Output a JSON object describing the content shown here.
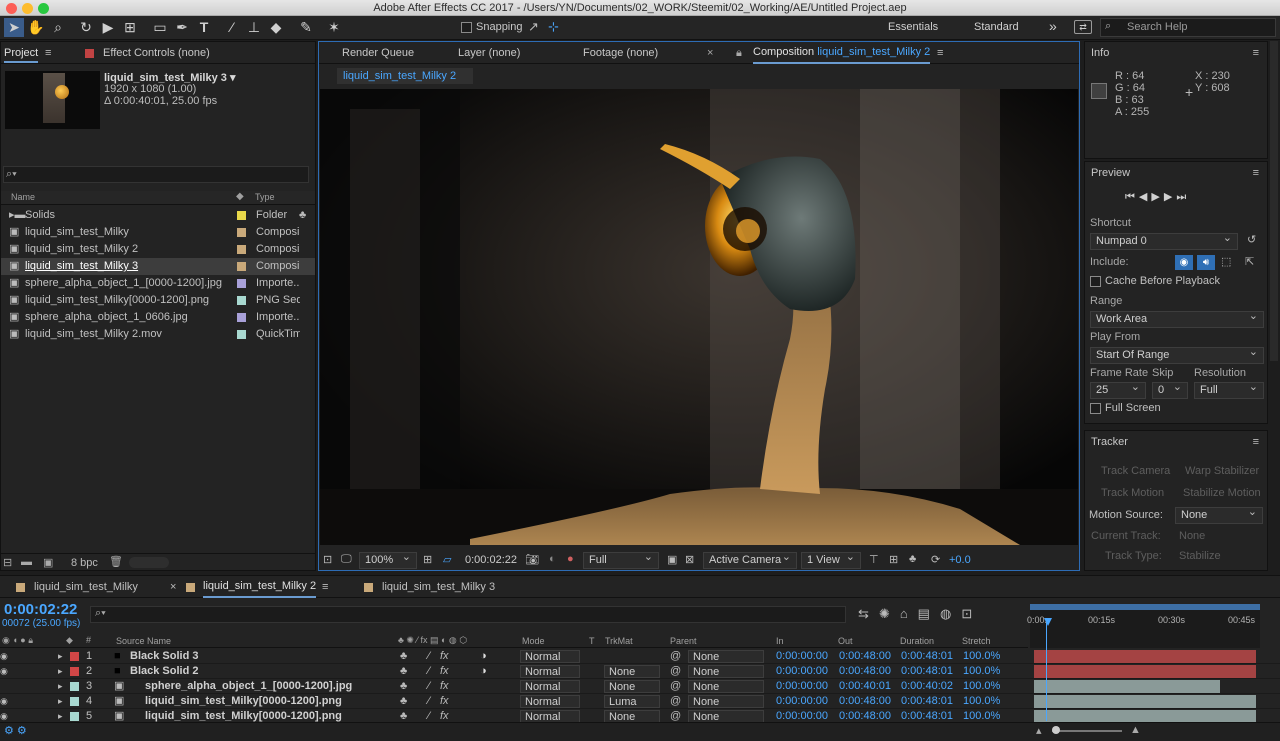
{
  "titlebar": {
    "title": "Adobe After Effects CC 2017 - /Users/YN/Documents/02_WORK/Steemit/02_Working/AE/Untitled Project.aep"
  },
  "toolbar": {
    "snapping": "Snapping",
    "workspaces": [
      "Essentials",
      "Standard"
    ],
    "search_placeholder": "Search Help"
  },
  "project": {
    "tab": "Project",
    "effect_controls": "Effect Controls (none)",
    "selected_name": "liquid_sim_test_Milky 3",
    "dimensions": "1920 x 1080 (1.00)",
    "duration": "Δ 0:00:40:01, 25.00 fps",
    "col_name": "Name",
    "col_type": "Type",
    "bpc": "8 bpc",
    "items": [
      {
        "name": "Solids",
        "type": "Folder",
        "color": "#e8d84a"
      },
      {
        "name": "liquid_sim_test_Milky",
        "type": "Composi",
        "color": "#c9a97a"
      },
      {
        "name": "liquid_sim_test_Milky 2",
        "type": "Composi",
        "color": "#c9a97a"
      },
      {
        "name": "liquid_sim_test_Milky 3",
        "type": "Composi",
        "color": "#c9a97a"
      },
      {
        "name": "sphere_alpha_object_1_[0000-1200].jpg",
        "type": "Importe...",
        "color": "#a8a0d8"
      },
      {
        "name": "liquid_sim_test_Milky[0000-1200].png",
        "type": "PNG Seq.",
        "color": "#a8d8d0"
      },
      {
        "name": "sphere_alpha_object_1_0606.jpg",
        "type": "Importe...",
        "color": "#a8a0d8"
      },
      {
        "name": "liquid_sim_test_Milky 2.mov",
        "type": "QuickTim",
        "color": "#a8d8d0"
      }
    ]
  },
  "viewer": {
    "tabs": [
      "Render Queue",
      "Layer (none)",
      "Footage (none)"
    ],
    "comp_prefix": "Composition",
    "comp_name": "liquid_sim_test_Milky 2",
    "subtab": "liquid_sim_test_Milky 2",
    "zoom": "100%",
    "timecode": "0:00:02:22",
    "resolution": "Full",
    "camera": "Active Camera",
    "views": "1 View",
    "exposure": "+0.0"
  },
  "info": {
    "title": "Info",
    "r": "R : 64",
    "g": "G : 64",
    "b": "B : 63",
    "a": "A : 255",
    "x": "X : 230",
    "y": "Y : 608"
  },
  "preview": {
    "title": "Preview",
    "shortcut_label": "Shortcut",
    "shortcut": "Numpad 0",
    "include": "Include:",
    "cache": "Cache Before Playback",
    "range_label": "Range",
    "range": "Work Area",
    "playfrom_label": "Play From",
    "playfrom": "Start Of Range",
    "framerate_label": "Frame Rate",
    "skip_label": "Skip",
    "resolution_label": "Resolution",
    "framerate": "25",
    "skip": "0",
    "resolution": "Full",
    "fullscreen": "Full Screen"
  },
  "tracker": {
    "title": "Tracker",
    "track_camera": "Track Camera",
    "warp": "Warp Stabilizer",
    "track_motion": "Track Motion",
    "stabilize": "Stabilize Motion",
    "motion_source_label": "Motion Source:",
    "motion_source": "None",
    "current_track_label": "Current Track:",
    "current_track": "None",
    "track_type_label": "Track Type:",
    "track_type": "Stabilize"
  },
  "timeline": {
    "tabs": [
      "liquid_sim_test_Milky",
      "liquid_sim_test_Milky 2",
      "liquid_sim_test_Milky 3"
    ],
    "timecode": "0:00:02:22",
    "frames": "00072 (25.00 fps)",
    "cols": {
      "source": "Source Name",
      "mode": "Mode",
      "t": "T",
      "trkmat": "TrkMat",
      "parent": "Parent",
      "in": "In",
      "out": "Out",
      "duration": "Duration",
      "stretch": "Stretch"
    },
    "ruler": [
      "0:00s",
      "00:15s",
      "00:30s",
      "00:45s"
    ],
    "layers": [
      {
        "num": "1",
        "name": "Black Solid 3",
        "color": "#d04646",
        "mode": "Normal",
        "trkmat": "",
        "parent": "None",
        "in": "0:00:00:00",
        "out": "0:00:48:00",
        "dur": "0:00:48:01",
        "stretch": "100.0%"
      },
      {
        "num": "2",
        "name": "Black Solid 2",
        "color": "#d04646",
        "mode": "Normal",
        "trkmat": "None",
        "parent": "None",
        "in": "0:00:00:00",
        "out": "0:00:48:00",
        "dur": "0:00:48:01",
        "stretch": "100.0%"
      },
      {
        "num": "3",
        "name": "sphere_alpha_object_1_[0000-1200].jpg",
        "color": "#a8d8d0",
        "mode": "Normal",
        "trkmat": "None",
        "parent": "None",
        "in": "0:00:00:00",
        "out": "0:00:40:01",
        "dur": "0:00:40:02",
        "stretch": "100.0%"
      },
      {
        "num": "4",
        "name": "liquid_sim_test_Milky[0000-1200].png",
        "color": "#a8d8d0",
        "mode": "Normal",
        "trkmat": "Luma",
        "parent": "None",
        "in": "0:00:00:00",
        "out": "0:00:48:00",
        "dur": "0:00:48:01",
        "stretch": "100.0%"
      },
      {
        "num": "5",
        "name": "liquid_sim_test_Milky[0000-1200].png",
        "color": "#a8d8d0",
        "mode": "Normal",
        "trkmat": "None",
        "parent": "None",
        "in": "0:00:00:00",
        "out": "0:00:48:00",
        "dur": "0:00:48:01",
        "stretch": "100.0%"
      }
    ]
  }
}
